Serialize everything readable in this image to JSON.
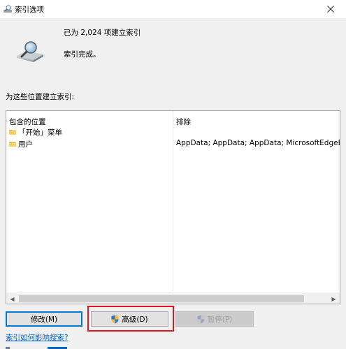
{
  "window": {
    "title": "索引选项"
  },
  "status": {
    "count_text": "已为 2,024 项建立索引",
    "state_text": "索引完成。"
  },
  "section": {
    "label": "为这些位置建立索引:"
  },
  "table": {
    "columns": {
      "included": "包含的位置",
      "excluded": "排除"
    },
    "rows": [
      {
        "location": "「开始」菜单",
        "exclude": ""
      },
      {
        "location": "用户",
        "exclude": "AppData; AppData; AppData; MicrosoftEdgeBa"
      }
    ]
  },
  "buttons": {
    "modify": "修改(M)",
    "advanced": "高级(D)",
    "pause": "暂停(P)"
  },
  "links": {
    "how_affects": "索引如何影响搜索?"
  },
  "colors": {
    "accent": "#0078d7",
    "highlight": "#e0141e",
    "link": "#0066cc"
  }
}
